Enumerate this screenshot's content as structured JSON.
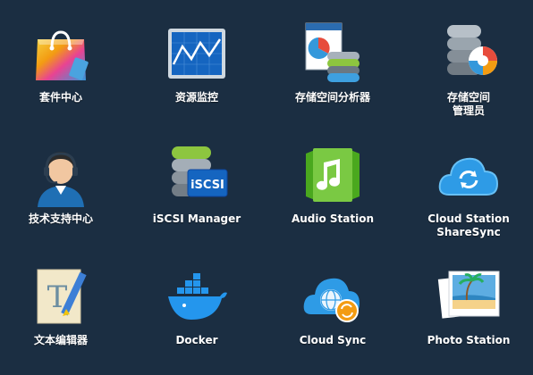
{
  "apps": [
    {
      "label": "套件中心",
      "label2": "",
      "icon": "package-center-icon"
    },
    {
      "label": "资源监控",
      "label2": "",
      "icon": "resource-monitor-icon"
    },
    {
      "label": "存储空间分析器",
      "label2": "",
      "icon": "storage-analyzer-icon"
    },
    {
      "label": "存储空间",
      "label2": "管理员",
      "icon": "storage-manager-icon"
    },
    {
      "label": "技术支持中心",
      "label2": "",
      "icon": "support-center-icon"
    },
    {
      "label": "iSCSI Manager",
      "label2": "",
      "icon": "iscsi-manager-icon"
    },
    {
      "label": "Audio Station",
      "label2": "",
      "icon": "audio-station-icon"
    },
    {
      "label": "Cloud Station",
      "label2": "ShareSync",
      "icon": "cloud-station-sharesync-icon"
    },
    {
      "label": "文本编辑器",
      "label2": "",
      "icon": "text-editor-icon"
    },
    {
      "label": "Docker",
      "label2": "",
      "icon": "docker-icon"
    },
    {
      "label": "Cloud Sync",
      "label2": "",
      "icon": "cloud-sync-icon"
    },
    {
      "label": "Photo Station",
      "label2": "",
      "icon": "photo-station-icon"
    }
  ],
  "colors": {
    "background": "#1b2e42",
    "label": "#ffffff"
  }
}
